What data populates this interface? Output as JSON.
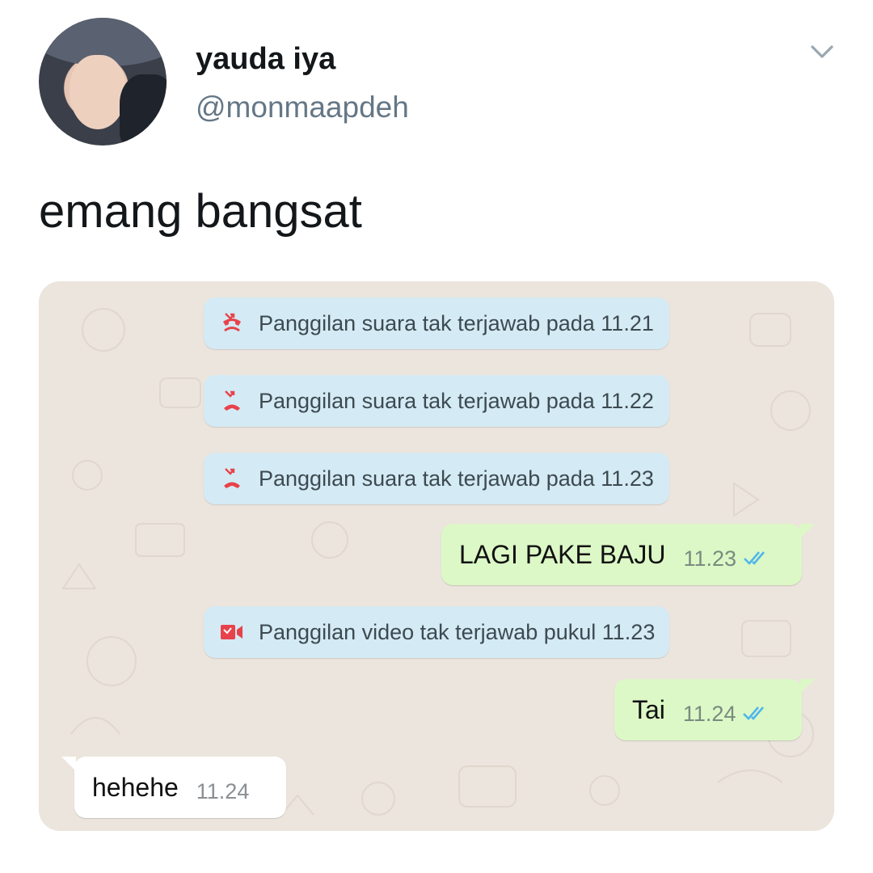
{
  "tweet": {
    "display_name": "yauda iya",
    "handle": "@monmaapdeh",
    "text": "emang bangsat"
  },
  "chat": {
    "system_messages": [
      {
        "icon": "missed-voice-call-icon",
        "text": "Panggilan suara tak terjawab pada 11.21"
      },
      {
        "icon": "missed-voice-call-icon",
        "text": "Panggilan suara tak terjawab pada 11.22"
      },
      {
        "icon": "missed-voice-call-icon",
        "text": "Panggilan suara tak terjawab pada 11.23"
      },
      {
        "icon": "missed-video-call-icon",
        "text": "Panggilan video tak terjawab pukul 11.23"
      }
    ],
    "messages": [
      {
        "direction": "outgoing",
        "text": "LAGI PAKE BAJU",
        "time": "11.23",
        "status": "read"
      },
      {
        "direction": "outgoing",
        "text": "Tai",
        "time": "11.24",
        "status": "read"
      },
      {
        "direction": "incoming",
        "text": "hehehe",
        "time": "11.24"
      }
    ]
  },
  "colors": {
    "outgoing_bubble": "#dcf8c6",
    "system_bubble": "#d4eaf4",
    "chat_background": "#ece5dd",
    "missed_call_red": "#e8424a",
    "read_ticks": "#4fb6ec"
  }
}
